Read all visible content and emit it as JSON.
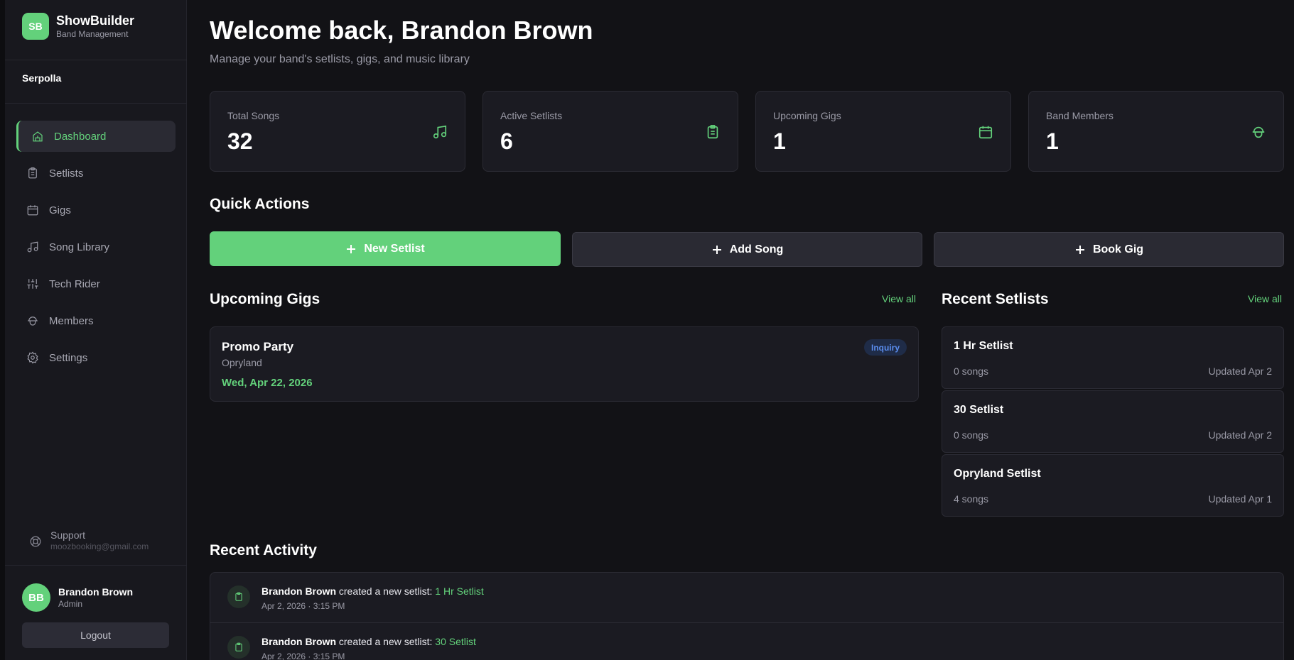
{
  "brand": {
    "logo_initials": "SB",
    "name": "ShowBuilder",
    "subtitle": "Band Management"
  },
  "band": {
    "name": "Serpolla"
  },
  "nav": [
    {
      "label": "Dashboard",
      "icon": "home-icon",
      "active": true
    },
    {
      "label": "Setlists",
      "icon": "clipboard-icon"
    },
    {
      "label": "Gigs",
      "icon": "calendar-icon"
    },
    {
      "label": "Song Library",
      "icon": "music-note-icon"
    },
    {
      "label": "Tech Rider",
      "icon": "sliders-icon"
    },
    {
      "label": "Members",
      "icon": "members-icon"
    },
    {
      "label": "Settings",
      "icon": "gear-icon"
    }
  ],
  "support": {
    "label": "Support",
    "email": "moozbooking@gmail.com"
  },
  "user": {
    "initials": "BB",
    "name": "Brandon Brown",
    "role": "Admin",
    "logout_label": "Logout"
  },
  "header": {
    "welcome": "Welcome back, Brandon Brown",
    "subtitle": "Manage your band's setlists, gigs, and music library"
  },
  "stats": [
    {
      "label": "Total Songs",
      "value": "32",
      "icon": "music-note-icon"
    },
    {
      "label": "Active Setlists",
      "value": "6",
      "icon": "clipboard-icon"
    },
    {
      "label": "Upcoming Gigs",
      "value": "1",
      "icon": "calendar-icon"
    },
    {
      "label": "Band Members",
      "value": "1",
      "icon": "members-icon"
    }
  ],
  "quick_actions": {
    "title": "Quick Actions",
    "buttons": [
      "New Setlist",
      "Add Song",
      "Book Gig"
    ]
  },
  "upcoming_gigs": {
    "title": "Upcoming Gigs",
    "view_all": "View all",
    "items": [
      {
        "name": "Promo Party",
        "venue": "Opryland",
        "date": "Wed, Apr 22, 2026",
        "status": "Inquiry"
      }
    ]
  },
  "recent_setlists": {
    "title": "Recent Setlists",
    "view_all": "View all",
    "items": [
      {
        "name": "1 Hr Setlist",
        "count": "0 songs",
        "updated": "Updated Apr 2"
      },
      {
        "name": "30 Setlist",
        "count": "0 songs",
        "updated": "Updated Apr 2"
      },
      {
        "name": "Opryland Setlist",
        "count": "4 songs",
        "updated": "Updated Apr 1"
      }
    ]
  },
  "recent_activity": {
    "title": "Recent Activity",
    "items": [
      {
        "user": "Brandon Brown",
        "action": " created a new setlist: ",
        "target": "1 Hr Setlist",
        "time": "Apr 2, 2026 · 3:15 PM"
      },
      {
        "user": "Brandon Brown",
        "action": " created a new setlist: ",
        "target": "30 Setlist",
        "time": "Apr 2, 2026 · 3:15 PM"
      }
    ]
  },
  "colors": {
    "accent": "#63d17b",
    "background": "#121216",
    "card": "#1b1b22",
    "badge_text": "#5b8ef0"
  }
}
